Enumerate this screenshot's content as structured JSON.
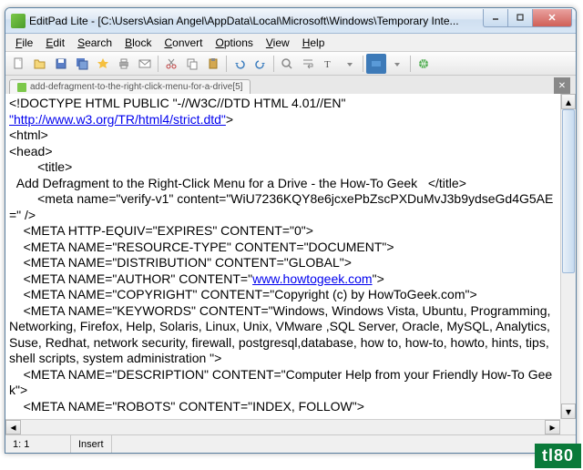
{
  "title": "EditPad Lite - [C:\\Users\\Asian Angel\\AppData\\Local\\Microsoft\\Windows\\Temporary Inte...",
  "menus": [
    "File",
    "Edit",
    "Search",
    "Block",
    "Convert",
    "Options",
    "View",
    "Help"
  ],
  "tab": {
    "label": "add-defragment-to-the-right-click-menu-for-a-drive[5]"
  },
  "status": {
    "pos": "1: 1",
    "mode": "Insert"
  },
  "content": {
    "l1a": "<!DOCTYPE HTML PUBLIC \"-//W3C//DTD HTML 4.01//EN\"",
    "l1link": "\"http://www.w3.org/TR/html4/strict.dtd\"",
    "l1b": ">",
    "l2": "<html>",
    "l3": "<head>",
    "l4": "        <title>",
    "l5": "  Add Defragment to the Right-Click Menu for a Drive - the How-To Geek   </title>",
    "l6": "        <meta name=\"verify-v1\" content=\"WiU7236KQY8e6jcxePbZscPXDuMvJ3b9ydseGd4G5AE=\" />",
    "l7": "    <META HTTP-EQUIV=\"EXPIRES\" CONTENT=\"0\">",
    "l8": "    <META NAME=\"RESOURCE-TYPE\" CONTENT=\"DOCUMENT\">",
    "l9": "    <META NAME=\"DISTRIBUTION\" CONTENT=\"GLOBAL\">",
    "l10a": "    <META NAME=\"AUTHOR\" CONTENT=\"",
    "l10link": "www.howtogeek.com",
    "l10b": "\">",
    "l11": "    <META NAME=\"COPYRIGHT\" CONTENT=\"Copyright (c) by HowToGeek.com\">",
    "l12": "    <META NAME=\"KEYWORDS\" CONTENT=\"Windows, Windows Vista, Ubuntu, Programming, Networking, Firefox, Help, Solaris, Linux, Unix, VMware ,SQL Server, Oracle, MySQL, Analytics, Suse, Redhat, network security, firewall, postgresql,database, how to, how-to, howto, hints, tips, shell scripts, system administration \">",
    "l13": "    <META NAME=\"DESCRIPTION\" CONTENT=\"Computer Help from your Friendly How-To Geek\">",
    "l14": "    <META NAME=\"ROBOTS\" CONTENT=\"INDEX, FOLLOW\">"
  },
  "watermark": "tl80"
}
